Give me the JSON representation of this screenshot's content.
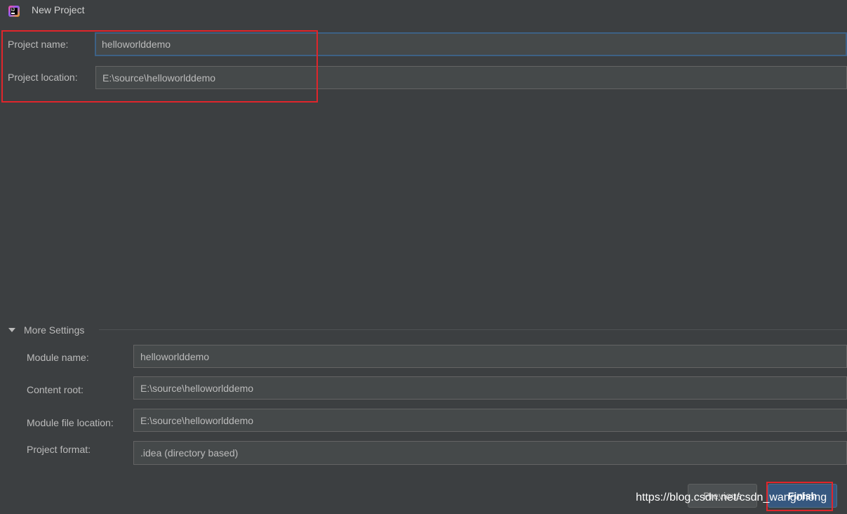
{
  "window": {
    "title": "New Project",
    "icon": "intellij-idea-icon"
  },
  "project": {
    "name_label": "Project name:",
    "name_value": "helloworlddemo",
    "location_label": "Project location:",
    "location_value": "E:\\source\\helloworlddemo"
  },
  "more_settings": {
    "label": "More Settings",
    "expanded": true,
    "module_name_label": "Module name:",
    "module_name_value": "helloworlddemo",
    "content_root_label": "Content root:",
    "content_root_value": "E:\\source\\helloworlddemo",
    "module_file_location_label": "Module file location:",
    "module_file_location_value": "E:\\source\\helloworlddemo",
    "project_format_label": "Project format:",
    "project_format_value": ".idea (directory based)"
  },
  "footer": {
    "previous_label": "Previous",
    "finish_label": "Finish"
  },
  "watermark": {
    "text": "https://blog.csdn.net/csdn_wangchong"
  },
  "colors": {
    "background": "#3c3f41",
    "field_background": "#45494a",
    "focus_border": "#3d6185",
    "annotation_red": "#e0252b",
    "primary_button": "#365880"
  }
}
